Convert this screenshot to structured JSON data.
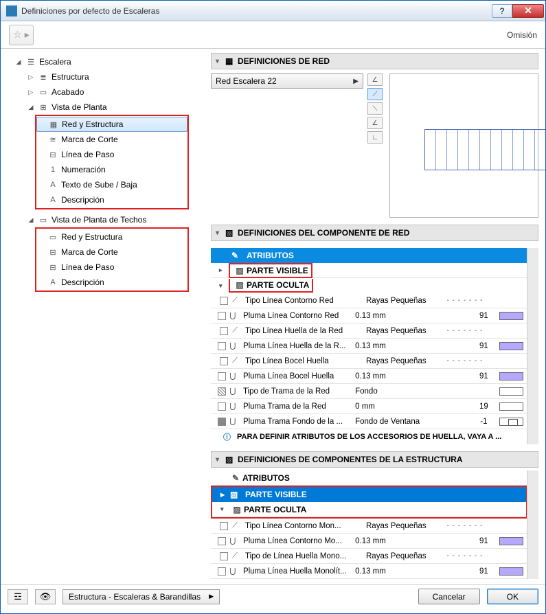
{
  "window": {
    "title": "Definiciones por defecto de Escaleras",
    "omission": "Omisión"
  },
  "tree": {
    "root_label": "Escalera",
    "estructura": "Estructura",
    "acabado": "Acabado",
    "vista_planta": "Vista de Planta",
    "planta_items": [
      "Red y Estructura",
      "Marca de Corte",
      "Línea de Paso",
      "Numeración",
      "Texto de Sube / Baja",
      "Descripción"
    ],
    "vista_techos": "Vista de Planta de Techos",
    "techos_items": [
      "Red y Estructura",
      "Marca de Corte",
      "Línea de Paso",
      "Descripción"
    ]
  },
  "panels": {
    "red_def": "DEFINICIONES DE RED",
    "comp_red": "DEFINICIONES DEL COMPONENTE DE RED",
    "comp_estr": "DEFINICIONES DE COMPONENTES DE LA ESTRUCTURA"
  },
  "net_dropdown": "Red Escalera 22",
  "attr_labels": {
    "atributos": "ATRIBUTOS",
    "visible": "PARTE VISIBLE",
    "oculta": "PARTE OCULTA",
    "info": "PARA DEFINIR ATRIBUTOS DE LOS ACCESORIOS DE HUELLA, VAYA A ..."
  },
  "red_rows": [
    {
      "name": "Tipo Línea Contorno Red",
      "val": "Rayas Pequeñas",
      "dash": "- - - - - - -",
      "num": "",
      "swatch": "none"
    },
    {
      "name": "Pluma Línea Contorno Red",
      "val": "0.13 mm",
      "dash": "",
      "num": "91",
      "swatch": "fill"
    },
    {
      "name": "Tipo Línea Huella de la Red",
      "val": "Rayas Pequeñas",
      "dash": "- - - - - - -",
      "num": "",
      "swatch": "none"
    },
    {
      "name": "Pluma Línea Huella de la R...",
      "val": "0.13 mm",
      "dash": "",
      "num": "91",
      "swatch": "fill"
    },
    {
      "name": "Tipo Línea Bocel Huella",
      "val": "Rayas Pequeñas",
      "dash": "- - - - - - -",
      "num": "",
      "swatch": "none"
    },
    {
      "name": "Pluma Línea Bocel Huella",
      "val": "0.13 mm",
      "dash": "",
      "num": "91",
      "swatch": "fill"
    },
    {
      "name": "Tipo de Trama de la Red",
      "val": "Fondo",
      "dash": "",
      "num": "",
      "swatch": "empty",
      "icon": "hatch"
    },
    {
      "name": "Pluma Trama de la Red",
      "val": "0 mm",
      "dash": "",
      "num": "19",
      "swatch": "empty"
    },
    {
      "name": "Pluma Trama Fondo de la ...",
      "val": "Fondo de Ventana",
      "dash": "",
      "num": "-1",
      "swatch": "mon",
      "icon": "gray"
    }
  ],
  "estr_rows": [
    {
      "name": "Tipo Línea Contorno Mon...",
      "val": "Rayas Pequeñas",
      "dash": "- - - - - - -",
      "num": "",
      "swatch": "none"
    },
    {
      "name": "Pluma Línea Contorno Mo...",
      "val": "0.13 mm",
      "dash": "",
      "num": "91",
      "swatch": "fill"
    },
    {
      "name": "Tipo de Línea Huella Mono...",
      "val": "Rayas Pequeñas",
      "dash": "- - - - - - -",
      "num": "",
      "swatch": "none"
    },
    {
      "name": "Pluma Línea Huella Monolít...",
      "val": "0.13 mm",
      "dash": "",
      "num": "91",
      "swatch": "fill"
    }
  ],
  "footer": {
    "layer_dd": "Estructura - Escaleras & Barandillas",
    "cancel": "Cancelar",
    "ok": "OK"
  }
}
